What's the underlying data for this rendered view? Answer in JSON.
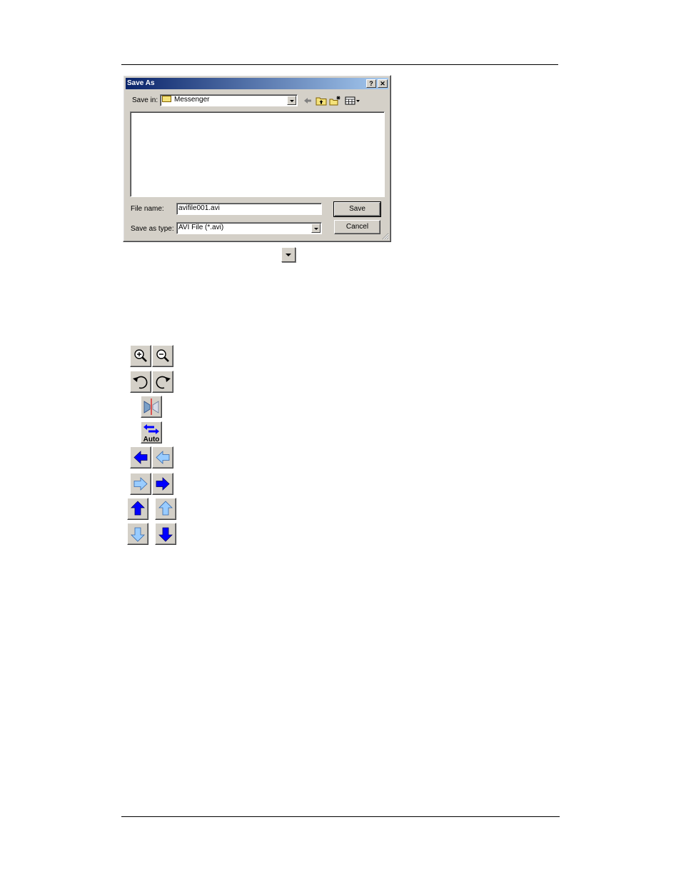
{
  "dialog": {
    "title": "Save As",
    "help_label": "?",
    "close_label": "✕",
    "save_in_label": "Save in:",
    "save_in_value": "Messenger",
    "file_name_label": "File name:",
    "file_name_value": "avifile001.avi",
    "save_as_type_label": "Save as type:",
    "save_as_type_value": "AVI File (*.avi)",
    "save_button": "Save",
    "cancel_button": "Cancel"
  },
  "icons": [
    "zoom-in-icon",
    "zoom-out-icon",
    "rotate-left-icon",
    "rotate-right-icon",
    "mirror-icon",
    "auto-swap-icon",
    "arrow-left-solid-icon",
    "arrow-left-outline-icon",
    "arrow-right-outline-icon",
    "arrow-right-solid-icon",
    "arrow-up-solid-icon",
    "arrow-up-outline-icon",
    "arrow-down-outline-icon",
    "arrow-down-solid-icon"
  ],
  "auto_label": "Auto",
  "colors": {
    "arrow_solid": "#0000ff",
    "arrow_outline": "#99ccff",
    "titlebar": "#0a246a"
  }
}
